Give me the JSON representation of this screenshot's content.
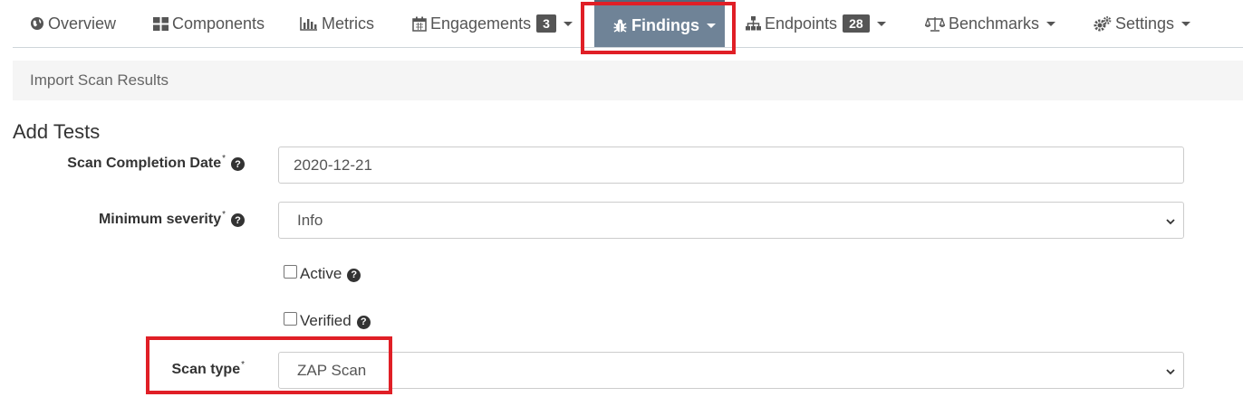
{
  "nav": {
    "overview": "Overview",
    "components": "Components",
    "metrics": "Metrics",
    "engagements": "Engagements",
    "engagements_count": "3",
    "findings": "Findings",
    "endpoints": "Endpoints",
    "endpoints_count": "28",
    "benchmarks": "Benchmarks",
    "settings": "Settings"
  },
  "breadcrumb": {
    "current": "Import Scan Results"
  },
  "form": {
    "title": "Add Tests",
    "scan_date_label": "Scan Completion Date",
    "scan_date_value": "2020-12-21",
    "min_severity_label": "Minimum severity",
    "min_severity_value": "Info",
    "active_label": "Active",
    "verified_label": "Verified",
    "scan_type_label": "Scan type",
    "scan_type_value": "ZAP Scan",
    "required_mark": "*",
    "help_glyph": "?"
  },
  "colors": {
    "highlight": "#e01f26",
    "active_tab": "#6f8397"
  },
  "icons": [
    "globe-icon",
    "grid-icon",
    "bar-chart-icon",
    "calendar-icon",
    "bug-icon",
    "sitemap-icon",
    "balance-icon",
    "gears-icon",
    "question-icon",
    "chevron-down-icon"
  ]
}
